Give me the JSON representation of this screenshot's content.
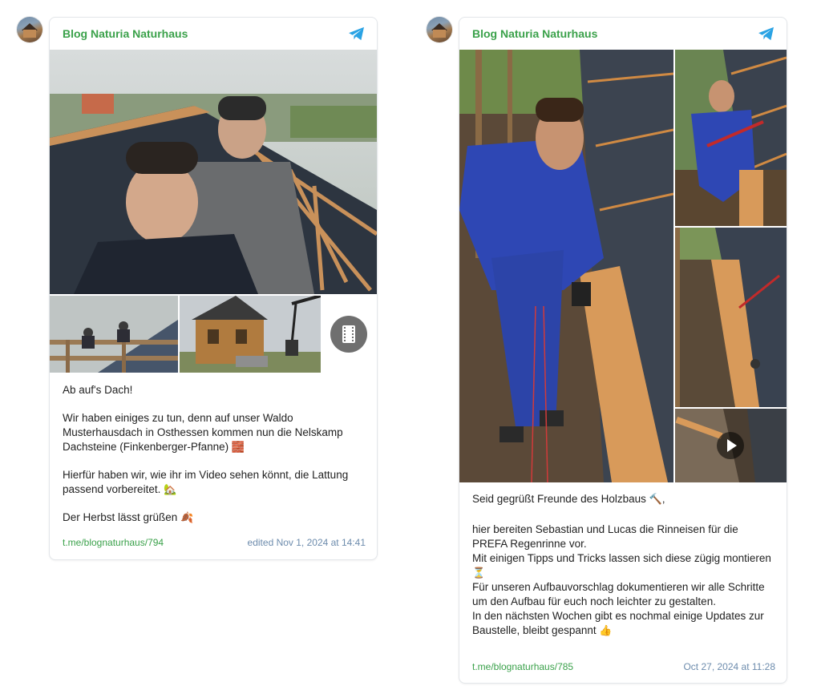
{
  "posts": [
    {
      "channel": "Blog Naturia Naturhaus",
      "caption": {
        "p1": "Ab auf's Dach!",
        "p2": "Wir haben einiges zu tun, denn auf unser Waldo Musterhausdach in Osthessen kommen nun die Nelskamp Dachsteine (Finkenberger-Pfanne)",
        "p2_emoji": "🧱",
        "p3": "Hierfür haben wir, wie ihr im Video sehen könnt, die Lattung passend vorbereitet.",
        "p3_emoji": "🏡",
        "p4": "Der Herbst lässt grüßen",
        "p4_emoji": "🍂"
      },
      "link": "t.me/blognaturhaus/794",
      "date": "edited  Nov 1, 2024 at 14:41"
    },
    {
      "channel": "Blog Naturia Naturhaus",
      "caption": {
        "l1": "Seid gegrüßt Freunde des Holzbaus",
        "l1_emoji": "🔨,",
        "l2": "hier bereiten Sebastian und Lucas die Rinneisen für die PREFA Regenrinne vor.",
        "l3": "Mit einigen Tipps und Tricks lassen sich diese zügig montieren",
        "l3_emoji": "⏳",
        "l4": "Für unseren Aufbauvorschlag dokumentieren wir alle Schritte um den Aufbau für euch noch leichter zu gestalten.",
        "l5": "In den nächsten Wochen gibt es nochmal einige Updates zur Baustelle, bleibt gespannt",
        "l5_emoji": "👍"
      },
      "link": "t.me/blognaturhaus/785",
      "date": "Oct 27, 2024 at 11:28"
    }
  ],
  "colors": {
    "channel": "#3aa14a",
    "link": "#3aa14a",
    "date": "#6d8cad",
    "telegram": "#2aa3e4"
  },
  "icons": {
    "channel_icon": "telegram-plane-icon",
    "video": "play-icon",
    "film": "film-icon"
  }
}
